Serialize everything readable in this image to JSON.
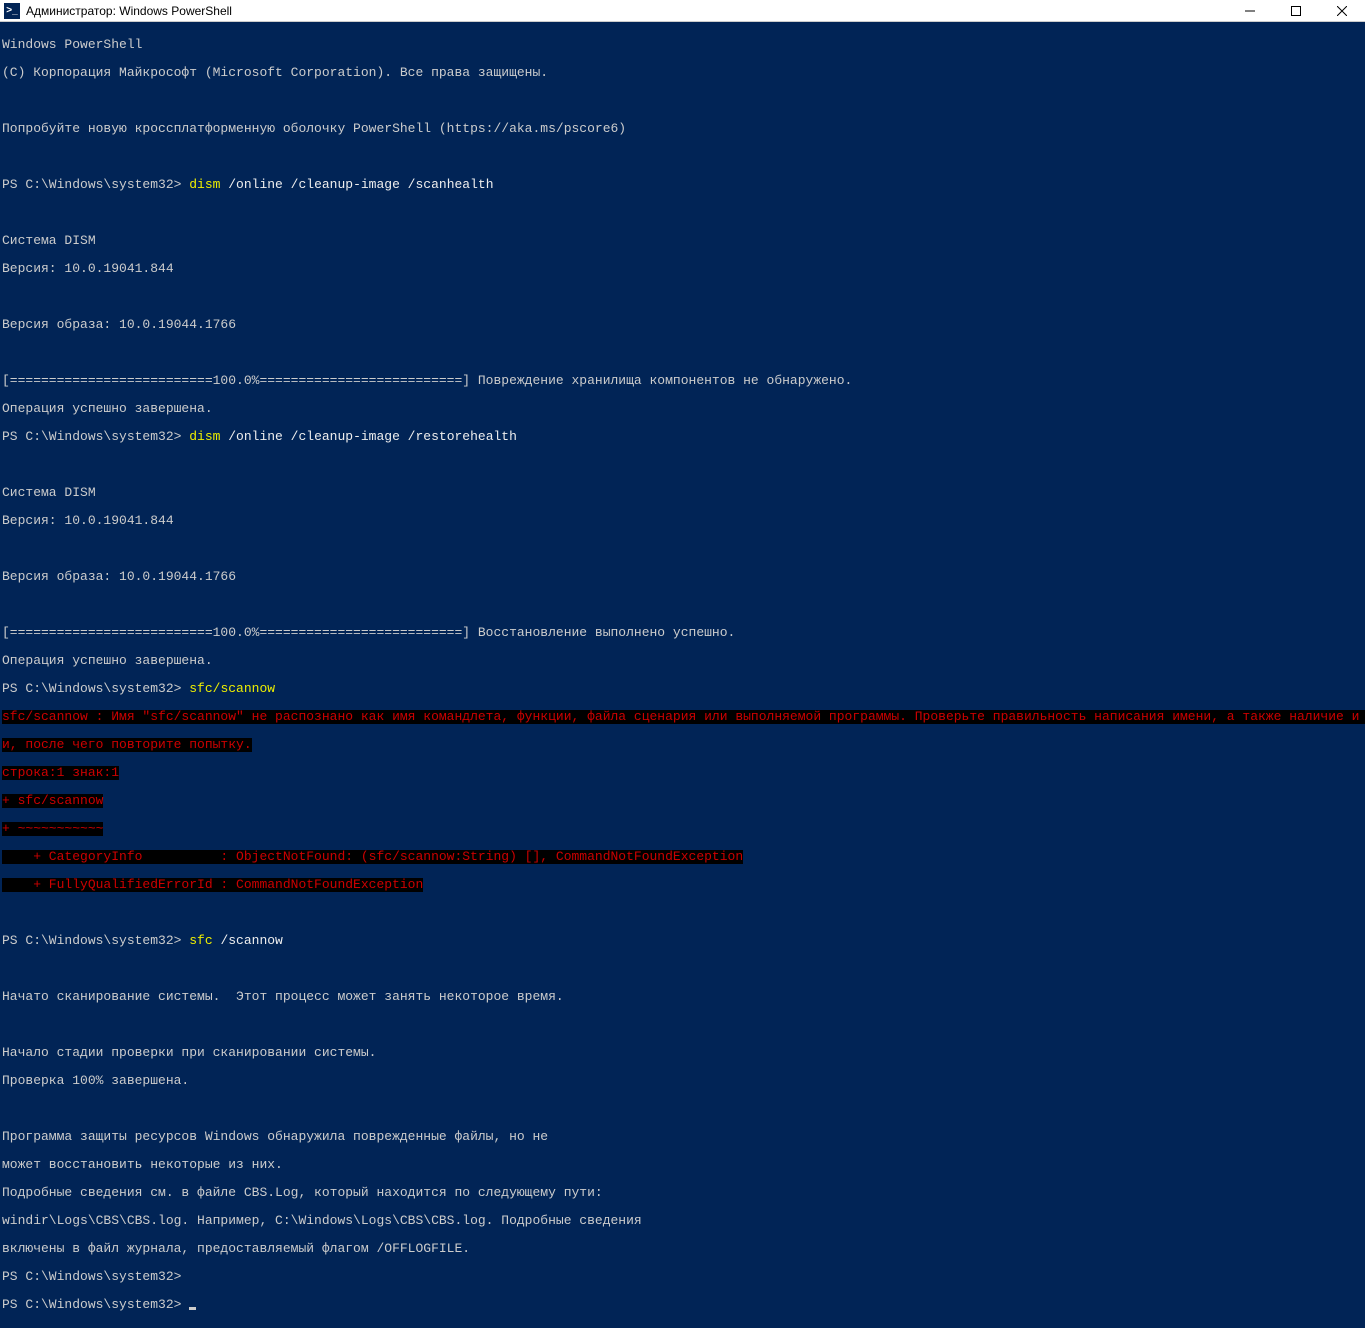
{
  "window": {
    "title": "Администратор: Windows PowerShell",
    "icon_glyph": ">_"
  },
  "header1": "Windows PowerShell",
  "header2": "(C) Корпорация Майкрософт (Microsoft Corporation). Все права защищены.",
  "trynew": "Попробуйте новую кроссплатформенную оболочку PowerShell (https://aka.ms/pscore6)",
  "prompt": "PS C:\\Windows\\system32> ",
  "cmd1_exe": "dism",
  "cmd1_args": " /online /cleanup-image /scanhealth",
  "dism_sys": "Cистема DISM",
  "dism_ver": "Версия: 10.0.19041.844",
  "image_ver": "Версия образа: 10.0.19044.1766",
  "progress1": "[==========================100.0%==========================] Повреждение хранилища компонентов не обнаружено.",
  "op_done": "Операция успешно завершена.",
  "cmd2_exe": "dism",
  "cmd2_args": " /online /cleanup-image /restorehealth",
  "progress2": "[==========================100.0%==========================] Восстановление выполнено успешно.",
  "cmd3": "sfc/scannow",
  "err1": "sfc/scannow : Имя \"sfc/scannow\" не распознано как имя командлета, функции, файла сценария или выполняемой программы. Проверьте правильность написания имени, а также наличие и правильность пут",
  "err2": "и, после чего повторите попытку.",
  "err3": "строка:1 знак:1",
  "err4": "+ sfc/scannow",
  "err5": "+ ~~~~~~~~~~~",
  "err6": "    + CategoryInfo          : ObjectNotFound: (sfc/scannow:String) [], CommandNotFoundException",
  "err7": "    + FullyQualifiedErrorId : CommandNotFoundException",
  "cmd4_exe": "sfc",
  "cmd4_args": " /scannow",
  "scan1": "Начато сканирование системы.  Этот процесс может занять некоторое время.",
  "scan2": "Начало стадии проверки при сканировании системы.",
  "scan3": "Проверка 100% завершена.",
  "res1": "Программа защиты ресурсов Windows обнаружила поврежденные файлы, но не",
  "res2": "может восстановить некоторые из них.",
  "res3": "Подробные сведения см. в файле CBS.Log, который находится по следующему пути:",
  "res4": "windir\\Logs\\CBS\\CBS.log. Например, C:\\Windows\\Logs\\CBS\\CBS.log. Подробные сведения",
  "res5": "включены в файл журнала, предоставляемый флагом /OFFLOGFILE."
}
